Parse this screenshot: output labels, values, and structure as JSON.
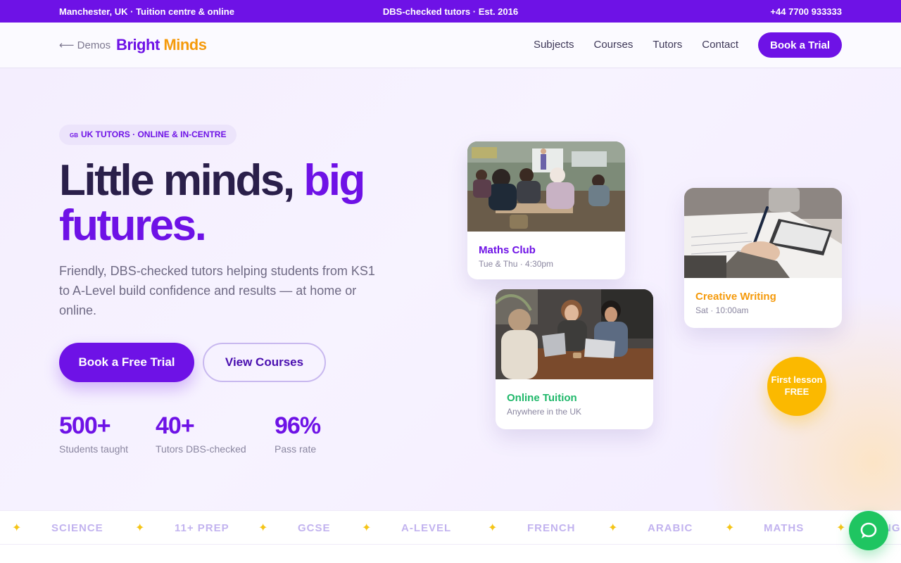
{
  "topbar": {
    "left": "Manchester, UK · Tuition centre & online",
    "center": "DBS-checked tutors · Est. 2016",
    "right": "+44 7700 933333"
  },
  "nav": {
    "back_label": "⟵ Demos",
    "logo_part1": "Bright",
    "logo_part2": "Minds",
    "links": [
      "Subjects",
      "Courses",
      "Tutors",
      "Contact"
    ],
    "cta_label": "Book a Trial"
  },
  "hero": {
    "badge_flag": "GB",
    "badge_text": "UK TUTORS · ONLINE & IN-CENTRE",
    "headline_part1": "Little minds,",
    "headline_accent": "big futures.",
    "subtext": "Friendly, DBS-checked tutors helping students from KS1 to A-Level build confidence and results — at home or online.",
    "primary_button": "Book a Free Trial",
    "secondary_button": "View Courses",
    "stats": [
      {
        "number": "500+",
        "label": "Students taught"
      },
      {
        "number": "40+",
        "label": "Tutors DBS-checked"
      },
      {
        "number": "96%",
        "label": "Pass rate"
      }
    ]
  },
  "cards": [
    {
      "title": "Maths Club",
      "meta": "Tue & Thu · 4:30pm",
      "color": "#6e12e6"
    },
    {
      "title": "Creative Writing",
      "meta": "Sat · 10:00am",
      "color": "#f59a0b"
    },
    {
      "title": "Online Tuition",
      "meta": "Anywhere in the UK",
      "color": "#1fb86a"
    }
  ],
  "free_badge": {
    "line1": "First lesson",
    "line2": "FREE"
  },
  "marquee": {
    "items": [
      "SCIENCE",
      "11+ PREP",
      "GCSE",
      "A-LEVEL",
      "FRENCH",
      "ARABIC",
      "MATHS",
      "ENGLISH"
    ],
    "separator": "✦"
  },
  "chat": {
    "icon": "chat-bubble-icon"
  },
  "colors": {
    "brand": "#6e12e6",
    "accent": "#f59a0b",
    "green": "#1fc561",
    "yellow": "#fbb900"
  }
}
